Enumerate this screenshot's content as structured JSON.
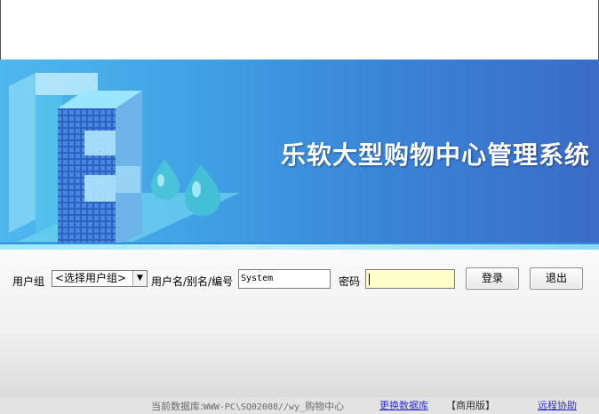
{
  "banner": {
    "app_title": "乐软大型购物中心管理系统"
  },
  "login": {
    "user_group_label": "用户组",
    "user_group_value": "<选择用户组>",
    "username_label": "用户名/别名/编号",
    "username_value": "System",
    "password_label": "密码",
    "password_value": "",
    "login_button": "登录",
    "exit_button": "退出"
  },
  "status": {
    "current_db_label": "当前数据库:",
    "current_db_value": "WWW-PC\\SQ02008//wy_",
    "current_db_name": "购物中心",
    "change_db_link": "更换数据库",
    "edition": "【商用版】",
    "remote_help_link": "远程协助"
  },
  "colors": {
    "banner_blue": "#3f9fe4",
    "title_text": "#ffffff",
    "password_bg": "#ffffc8",
    "link": "#3030d0"
  }
}
